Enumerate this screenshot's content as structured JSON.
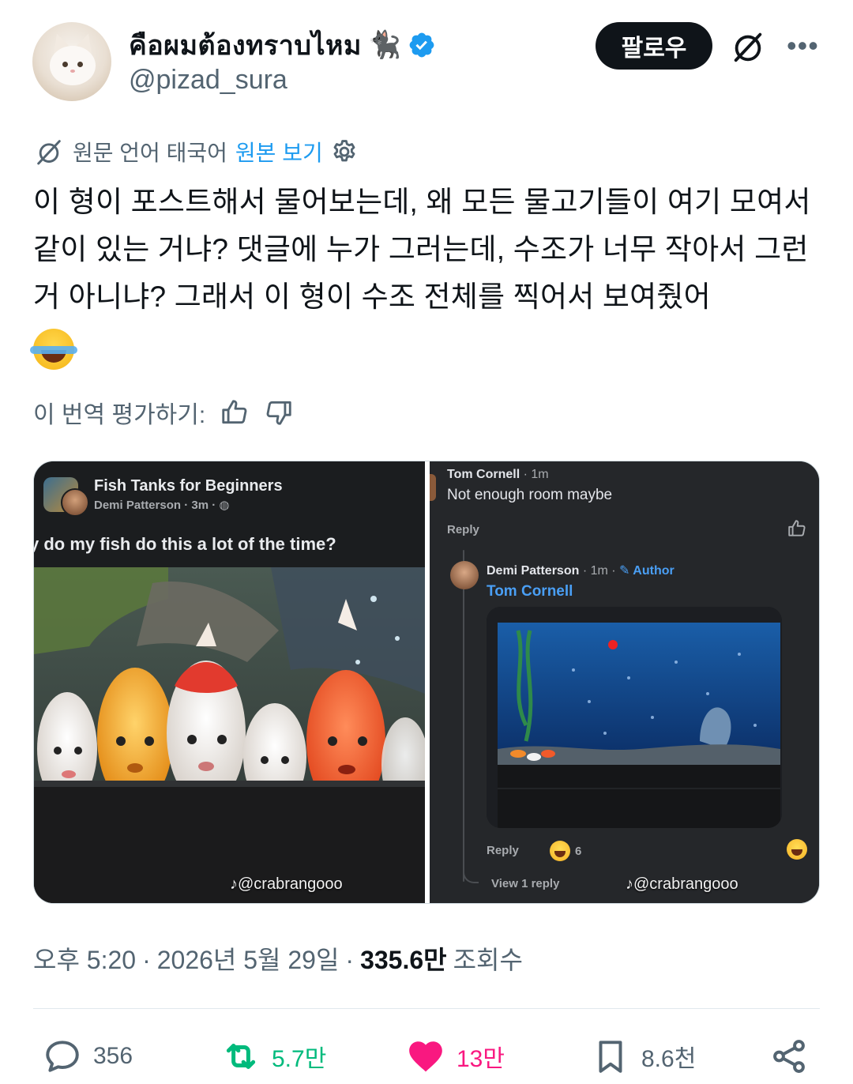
{
  "author": {
    "display_name": "คือผมต้องทราบไหม",
    "name_emoji": "🐈‍⬛",
    "handle": "@pizad_sura",
    "verified": true,
    "verified_color": "#1d9bf0"
  },
  "header": {
    "follow_label": "팔로우",
    "more_label": "•••"
  },
  "translation": {
    "source_label": "원문 언어 태국어",
    "view_original_label": "원본 보기"
  },
  "tweet": {
    "text": "이 형이 포스트해서 물어보는데, 왜 모든 물고기들이 여기 모여서 같이 있는 거냐? 댓글에 누가 그러는데, 수조가 너무 작아서 그런 거 아니냐? 그래서 이 형이 수조 전체를 찍어서 보여줬어",
    "trailing_emoji": "joy-tears-emoji"
  },
  "rate_translation": {
    "label": "이 번역 평가하기:"
  },
  "media": {
    "left": {
      "group_title": "Fish Tanks for Beginners",
      "poster": "Demi Patterson · 3m · ",
      "post_text": "y do my fish do this a lot of the time?",
      "watermark": "@crabrangooo"
    },
    "right": {
      "comment1": {
        "name": "Tom Cornell",
        "time": " · 1m",
        "text": "Not enough room maybe",
        "reply_label": "Reply"
      },
      "comment2": {
        "name": "Demi Patterson",
        "time": " · 1m · ",
        "author_badge": "✎ Author",
        "mention": "Tom Cornell",
        "reply_label": "Reply",
        "reaction_count": "6"
      },
      "view_replies_label": "View 1 reply",
      "watermark": "@crabrangooo"
    }
  },
  "meta": {
    "time": "오후 5:20",
    "date": "2026년 5월 29일",
    "separator": "·",
    "views_count": "335.6만",
    "views_label": "조회수"
  },
  "actions": {
    "replies": "356",
    "retweets": "5.7만",
    "likes": "13만",
    "bookmarks": "8.6천"
  },
  "colors": {
    "text_primary": "#0f1419",
    "text_secondary": "#536471",
    "link": "#1d9bf0",
    "retweet": "#00ba7c",
    "like": "#f91880"
  }
}
